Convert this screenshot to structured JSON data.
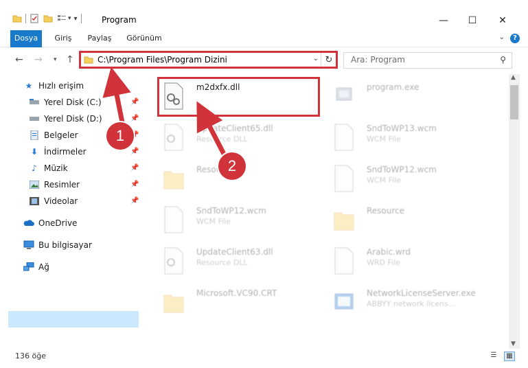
{
  "window": {
    "title": "Program"
  },
  "ribbon": {
    "tabs": [
      "Dosya",
      "Giriş",
      "Paylaş",
      "Görünüm"
    ],
    "help_label": "?"
  },
  "address": {
    "path": "C:\\Program Files\\Program Dizini"
  },
  "search": {
    "placeholder": "Ara: Program"
  },
  "sidebar": {
    "items": [
      {
        "label": "Hızlı erişim",
        "icon": "star-icon"
      },
      {
        "label": "Yerel Disk (C:)",
        "icon": "drive-icon"
      },
      {
        "label": "Yerel Disk (D:)",
        "icon": "drive-icon"
      },
      {
        "label": "Belgeler",
        "icon": "documents-icon"
      },
      {
        "label": "İndirmeler",
        "icon": "download-icon"
      },
      {
        "label": "Müzik",
        "icon": "music-icon"
      },
      {
        "label": "Resimler",
        "icon": "pictures-icon"
      },
      {
        "label": "Videolar",
        "icon": "videos-icon"
      },
      {
        "label": "OneDrive",
        "icon": "cloud-icon"
      },
      {
        "label": "Bu bilgisayar",
        "icon": "computer-icon"
      },
      {
        "label": "Ağ",
        "icon": "network-icon"
      }
    ]
  },
  "files": [
    {
      "name": "m2dxfx.dll",
      "type": "",
      "icon": "dll-icon"
    },
    {
      "name": "program.exe",
      "type": "",
      "icon": "exe-icon"
    },
    {
      "name": "UpdateClient65.dll",
      "type": "Resource DLL",
      "icon": "dll-icon"
    },
    {
      "name": "SndToWP13.wcm",
      "type": "WCM File",
      "icon": "file-icon"
    },
    {
      "name": "Resource",
      "type": "",
      "icon": "folder-icon"
    },
    {
      "name": "SndToWP12.wcm",
      "type": "WCM File",
      "icon": "file-icon"
    },
    {
      "name": "SndToWP12.wcm",
      "type": "WCM File",
      "icon": "file-icon"
    },
    {
      "name": "Resource",
      "type": "",
      "icon": "folder-icon"
    },
    {
      "name": "UpdateClient63.dll",
      "type": "Resource DLL",
      "icon": "dll-icon"
    },
    {
      "name": "Arabic.wrd",
      "type": "WRD File",
      "icon": "file-icon"
    },
    {
      "name": "Microsoft.VC90.CRT",
      "type": "",
      "icon": "folder-icon"
    },
    {
      "name": "NetworkLicenseServer.exe",
      "type": "ABBYY network licens...",
      "icon": "exe-icon"
    }
  ],
  "status": {
    "count": "136 öğe"
  },
  "annotations": {
    "badge1": "1",
    "badge2": "2"
  },
  "colors": {
    "accent": "#1979ca",
    "highlight": "#d0343a",
    "selected": "#cce8ff"
  }
}
